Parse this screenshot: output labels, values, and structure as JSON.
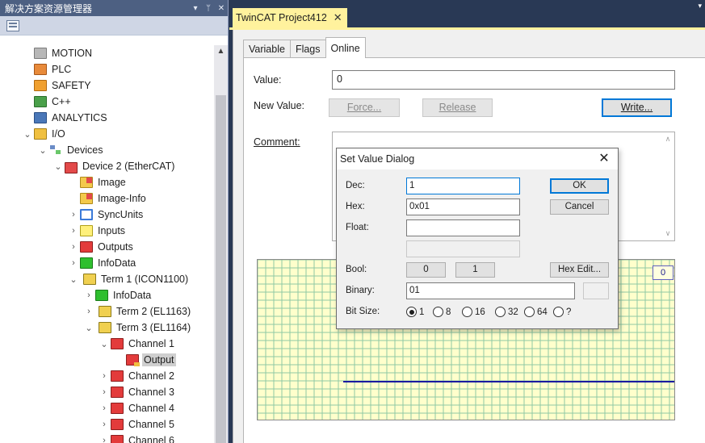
{
  "solution_explorer": {
    "title": "解决方案资源管理器",
    "buttons": {
      "dropdown": "▾",
      "pin": "ᛘ",
      "close": "✕"
    }
  },
  "tree": [
    {
      "label": "MOTION",
      "icon": "motion-icon",
      "expander": ""
    },
    {
      "label": "PLC",
      "icon": "plc-icon",
      "expander": ""
    },
    {
      "label": "SAFETY",
      "icon": "safety-icon",
      "expander": ""
    },
    {
      "label": "C++",
      "icon": "cpp-icon",
      "expander": ""
    },
    {
      "label": "ANALYTICS",
      "icon": "analytics-icon",
      "expander": ""
    },
    {
      "label": "I/O",
      "icon": "io-icon",
      "expander": "⌄"
    },
    {
      "label": "Devices",
      "icon": "devices-icon",
      "expander": "⌄"
    },
    {
      "label": "Device 2 (EtherCAT)",
      "icon": "ethercat-device-icon",
      "expander": "⌄"
    },
    {
      "label": "Image",
      "icon": "image-icon",
      "expander": ""
    },
    {
      "label": "Image-Info",
      "icon": "image-info-icon",
      "expander": ""
    },
    {
      "label": "SyncUnits",
      "icon": "syncunits-icon",
      "expander": "›"
    },
    {
      "label": "Inputs",
      "icon": "inputs-icon",
      "expander": "›"
    },
    {
      "label": "Outputs",
      "icon": "outputs-icon",
      "expander": "›"
    },
    {
      "label": "InfoData",
      "icon": "infodata-icon",
      "expander": "›"
    },
    {
      "label": "Term 1 (ICON1100)",
      "icon": "terminal-icon",
      "expander": "⌄"
    },
    {
      "label": "InfoData",
      "icon": "infodata-icon",
      "expander": "›"
    },
    {
      "label": "Term 2 (EL1163)",
      "icon": "terminal-icon",
      "expander": "›"
    },
    {
      "label": "Term 3 (EL1164)",
      "icon": "terminal-icon",
      "expander": "⌄"
    },
    {
      "label": "Channel 1",
      "icon": "channel-icon",
      "expander": "⌄"
    },
    {
      "label": "Output",
      "icon": "output-variable-icon",
      "expander": ""
    },
    {
      "label": "Channel 2",
      "icon": "channel-icon",
      "expander": "›"
    },
    {
      "label": "Channel 3",
      "icon": "channel-icon",
      "expander": "›"
    },
    {
      "label": "Channel 4",
      "icon": "channel-icon",
      "expander": "›"
    },
    {
      "label": "Channel 5",
      "icon": "channel-icon",
      "expander": "›"
    },
    {
      "label": "Channel 6",
      "icon": "channel-icon",
      "expander": "›"
    }
  ],
  "document": {
    "tab_title": "TwinCAT Project412",
    "tab_close": "✕",
    "inner_tabs": [
      "Variable",
      "Flags",
      "Online"
    ],
    "active_inner_tab": "Online",
    "value_label": "Value:",
    "value": "0",
    "new_value_label": "New Value:",
    "force_button": "Force...",
    "release_button": "Release",
    "write_button": "Write...",
    "comment_label": "Comment:",
    "chart_value_badge": "0"
  },
  "dialog": {
    "title": "Set Value Dialog",
    "close": "✕",
    "dec_label": "Dec:",
    "dec_value": "1",
    "hex_label": "Hex:",
    "hex_value": "0x01",
    "float_label": "Float:",
    "float_value": "",
    "ok_button": "OK",
    "cancel_button": "Cancel",
    "bool_label": "Bool:",
    "bool_0": "0",
    "bool_1": "1",
    "hex_edit_button": "Hex Edit...",
    "binary_label": "Binary:",
    "binary_value": "01",
    "bit_size_label": "Bit Size:",
    "bit_sizes": [
      "1",
      "8",
      "16",
      "32",
      "64",
      "?"
    ],
    "selected_bit_size": "1"
  },
  "colors": {
    "chart_background": "#ffffcc",
    "chart_grid": "#8fc8a5",
    "chart_trace": "#1a1aa0",
    "doc_tab": "#fff29d",
    "selection": "#cfcfcf"
  }
}
